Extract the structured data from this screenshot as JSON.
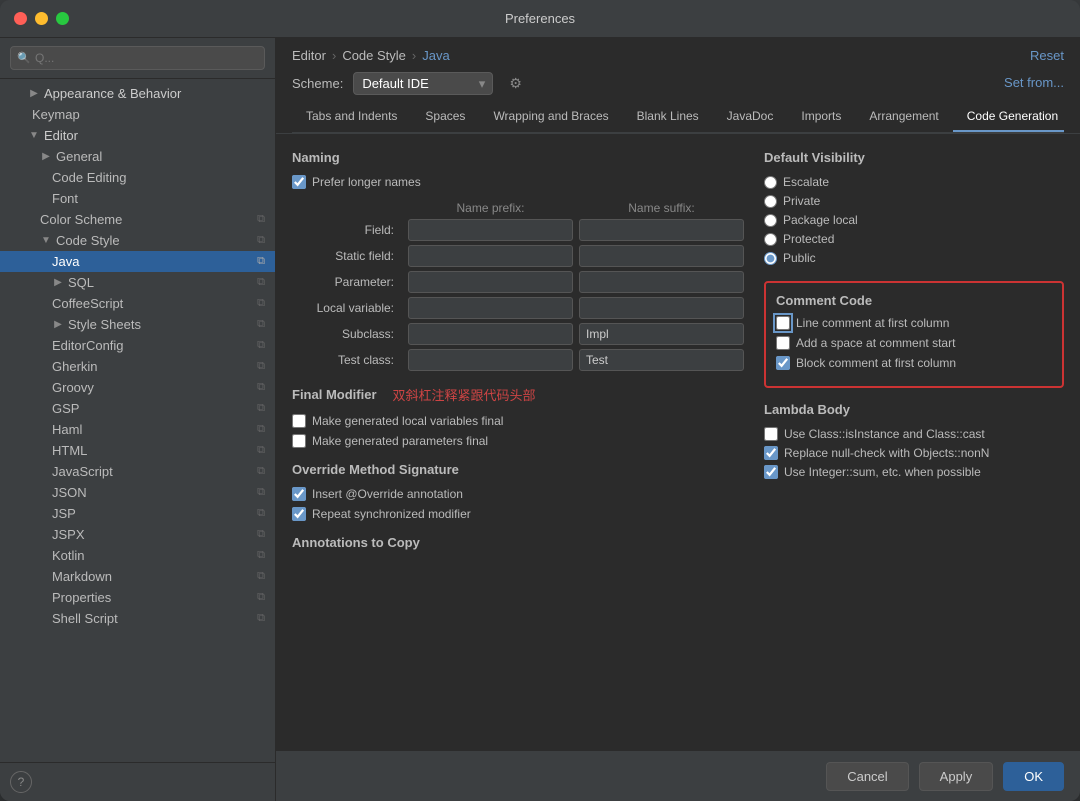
{
  "window": {
    "title": "Preferences"
  },
  "breadcrumb": {
    "items": [
      "Editor",
      "Code Style",
      "Java"
    ]
  },
  "scheme": {
    "label": "Scheme:",
    "default_text": "Default",
    "ide_text": "IDE",
    "reset_label": "Reset",
    "set_from_label": "Set from..."
  },
  "tabs": [
    {
      "label": "Tabs and Indents",
      "active": false
    },
    {
      "label": "Spaces",
      "active": false
    },
    {
      "label": "Wrapping and Braces",
      "active": false
    },
    {
      "label": "Blank Lines",
      "active": false
    },
    {
      "label": "JavaDoc",
      "active": false
    },
    {
      "label": "Imports",
      "active": false
    },
    {
      "label": "Arrangement",
      "active": false
    },
    {
      "label": "Code Generation",
      "active": true
    }
  ],
  "naming": {
    "title": "Naming",
    "prefer_longer_label": "Prefer longer names",
    "name_prefix_label": "Name prefix:",
    "name_suffix_label": "Name suffix:",
    "rows": [
      {
        "label": "Field:",
        "prefix": "",
        "suffix": ""
      },
      {
        "label": "Static field:",
        "prefix": "",
        "suffix": ""
      },
      {
        "label": "Parameter:",
        "prefix": "",
        "suffix": ""
      },
      {
        "label": "Local variable:",
        "prefix": "",
        "suffix": ""
      },
      {
        "label": "Subclass:",
        "prefix": "",
        "suffix": "Impl"
      },
      {
        "label": "Test class:",
        "prefix": "",
        "suffix": "Test"
      }
    ]
  },
  "final_modifier": {
    "title": "Final Modifier",
    "annotation_text": "双斜杠注释紧跟代码头部",
    "make_local_final": "Make generated local variables final",
    "make_params_final": "Make generated parameters final"
  },
  "override_method": {
    "title": "Override Method Signature",
    "insert_override": "Insert @Override annotation",
    "repeat_synchronized": "Repeat synchronized modifier"
  },
  "annotations_to_copy": {
    "title": "Annotations to Copy"
  },
  "default_visibility": {
    "title": "Default Visibility",
    "options": [
      {
        "label": "Escalate",
        "selected": false
      },
      {
        "label": "Private",
        "selected": false
      },
      {
        "label": "Package local",
        "selected": false
      },
      {
        "label": "Protected",
        "selected": false
      },
      {
        "label": "Public",
        "selected": true
      }
    ]
  },
  "comment_code": {
    "title": "Comment Code",
    "line_comment_first_col": "Line comment at first column",
    "add_space_comment": "Add a space at comment start",
    "block_comment_first_col": "Block comment at first column",
    "line_checked": false,
    "add_space_checked": false,
    "block_checked": true
  },
  "lambda_body": {
    "title": "Lambda Body",
    "use_class_instance": "Use Class::isInstance and Class::cast",
    "replace_null_check": "Replace null-check with Objects::nonN",
    "use_integer_sum": "Use Integer::sum, etc. when possible",
    "use_class_checked": false,
    "replace_null_checked": true,
    "use_integer_checked": true
  },
  "sidebar": {
    "search_placeholder": "Q...",
    "items": [
      {
        "label": "Appearance & Behavior",
        "level": 0,
        "expanded": true,
        "has_children": true
      },
      {
        "label": "Keymap",
        "level": 1,
        "expanded": false
      },
      {
        "label": "Editor",
        "level": 0,
        "expanded": true,
        "has_children": true
      },
      {
        "label": "General",
        "level": 1,
        "expanded": false,
        "has_children": true
      },
      {
        "label": "Code Editing",
        "level": 2
      },
      {
        "label": "Font",
        "level": 2
      },
      {
        "label": "Color Scheme",
        "level": 1,
        "has_copy": true
      },
      {
        "label": "Code Style",
        "level": 1,
        "expanded": true,
        "has_children": true,
        "has_copy": true
      },
      {
        "label": "Java",
        "level": 2,
        "selected": true,
        "has_copy": true
      },
      {
        "label": "SQL",
        "level": 2,
        "has_children": true,
        "has_copy": true
      },
      {
        "label": "CoffeeScript",
        "level": 2,
        "has_copy": true
      },
      {
        "label": "Style Sheets",
        "level": 2,
        "has_children": true,
        "has_copy": true
      },
      {
        "label": "EditorConfig",
        "level": 2,
        "has_copy": true
      },
      {
        "label": "Gherkin",
        "level": 2,
        "has_copy": true
      },
      {
        "label": "Groovy",
        "level": 2,
        "has_copy": true
      },
      {
        "label": "GSP",
        "level": 2,
        "has_copy": true
      },
      {
        "label": "Haml",
        "level": 2,
        "has_copy": true
      },
      {
        "label": "HTML",
        "level": 2,
        "has_copy": true
      },
      {
        "label": "JavaScript",
        "level": 2,
        "has_copy": true
      },
      {
        "label": "JSON",
        "level": 2,
        "has_copy": true
      },
      {
        "label": "JSP",
        "level": 2,
        "has_copy": true
      },
      {
        "label": "JSPX",
        "level": 2,
        "has_copy": true
      },
      {
        "label": "Kotlin",
        "level": 2,
        "has_copy": true
      },
      {
        "label": "Markdown",
        "level": 2,
        "has_copy": true
      },
      {
        "label": "Properties",
        "level": 2,
        "has_copy": true
      },
      {
        "label": "Shell Script",
        "level": 2,
        "has_copy": true
      }
    ]
  },
  "footer": {
    "cancel_label": "Cancel",
    "apply_label": "Apply",
    "ok_label": "OK"
  }
}
